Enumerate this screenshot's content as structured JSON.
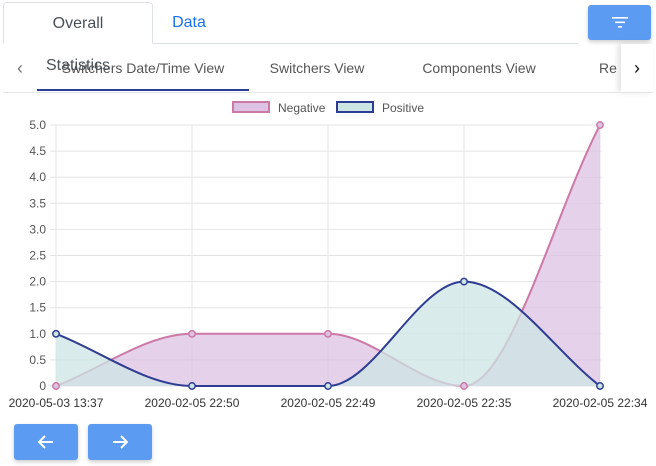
{
  "top_tabs": [
    {
      "label": "Overall Statistics",
      "active": true
    },
    {
      "label": "Data",
      "active": false
    }
  ],
  "filter_button": {
    "icon": "filter-icon"
  },
  "sub_tabs": [
    {
      "label": "Switchers Date/Time View",
      "active": true
    },
    {
      "label": "Switchers View",
      "active": false
    },
    {
      "label": "Components View",
      "active": false
    },
    {
      "label": "Re",
      "active": false
    }
  ],
  "colors": {
    "accent": "#5b9bf2",
    "tab_link": "#1a73e8",
    "active_underline": "#2c3e95",
    "negative_line": "#cc79a7",
    "negative_fill": "#dcc2e3",
    "positive_line": "#2e3d93",
    "positive_fill": "#cce6e4"
  },
  "chart_data": {
    "type": "area",
    "categories": [
      "2020-05-03 13:37",
      "2020-02-05 22:50",
      "2020-02-05 22:49",
      "2020-02-05 22:35",
      "2020-02-05 22:34"
    ],
    "series": [
      {
        "name": "Negative",
        "values": [
          0,
          1,
          1,
          0,
          5
        ]
      },
      {
        "name": "Positive",
        "values": [
          1,
          0,
          0,
          2,
          0
        ]
      }
    ],
    "ylim": [
      0,
      5
    ],
    "yticks": [
      "0",
      "0.5",
      "1.0",
      "1.5",
      "2.0",
      "2.5",
      "3.0",
      "3.5",
      "4.0",
      "4.5",
      "5.0"
    ],
    "legend_position": "top-center",
    "grid": true
  },
  "nav": {
    "prev_icon": "arrow-left-icon",
    "next_icon": "arrow-right-icon"
  }
}
